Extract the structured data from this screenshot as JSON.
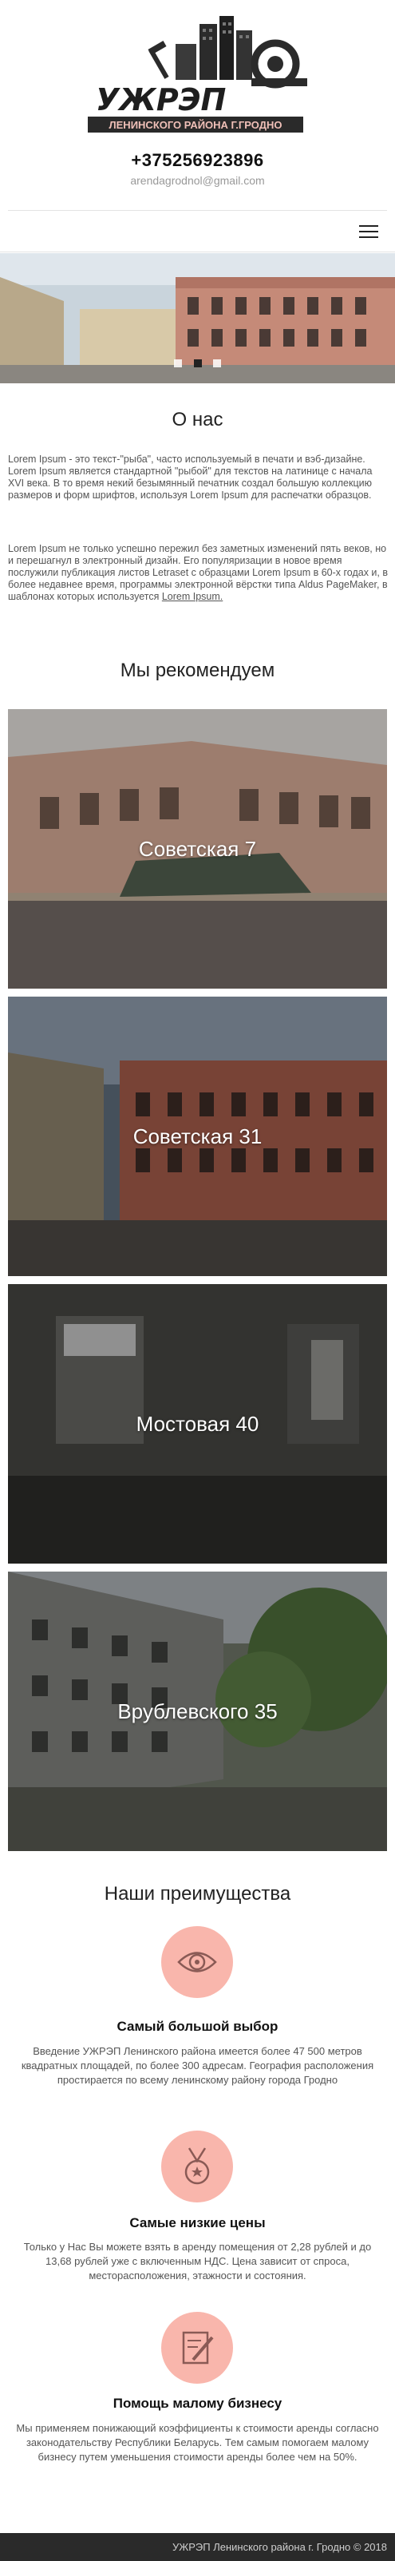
{
  "header": {
    "logo_title": "УЖРЭП",
    "logo_subtitle": "ЛЕНИНСКОГО РАЙОНА Г.ГРОДНО",
    "phone": "+375256923896",
    "email": "arendagrodnol@gmail.com",
    "menu_icon": "hamburger-icon"
  },
  "slider": {
    "slide_count": 3,
    "active_index": 1
  },
  "about": {
    "title": "О нас",
    "paragraph1": "Lorem Ipsum - это текст-\"рыба\", часто используемый в печати и вэб-дизайне. Lorem Ipsum является стандартной \"рыбой\" для текстов на латинице с начала XVI века. В то время некий безымянный печатник создал большую коллекцию размеров и форм шрифтов, используя Lorem Ipsum для распечатки образцов.",
    "paragraph2": "Lorem Ipsum не только успешно пережил без заметных изменений пять веков, но и перешагнул в электронный дизайн. Его популяризации в новое время послужили публикация листов Letraset с образцами Lorem Ipsum в 60-х годах и, в более недавнее время, программы электронной вёрстки типа Aldus PageMaker, в шаблонах которых используется",
    "link": "Lorem Ipsum."
  },
  "recommend": {
    "title": "Мы рекомендуем",
    "items": [
      {
        "label": "Советская 7"
      },
      {
        "label": "Советская 31"
      },
      {
        "label": "Мостовая 40"
      },
      {
        "label": "Врублевского 35"
      }
    ]
  },
  "advantages": {
    "title": "Наши преимущества",
    "items": [
      {
        "icon": "eye-icon",
        "title": "Самый большой выбор",
        "text": "Введение УЖРЭП Ленинского района имеется более 47 500 метров квадратных площадей, по более 300 адресам. География расположения простирается по всему ленинскому району города Гродно"
      },
      {
        "icon": "medal-icon",
        "title": "Самые низкие цены",
        "text": "Только у Нас Вы можете взять в аренду помещения от 2,28 рублей и до 13,68 рублей уже с включенным НДС. Цена зависит от спроса, месторасположения, этажности и состояния."
      },
      {
        "icon": "edit-icon",
        "title": "Помощь малому бизнесу",
        "text": "Мы применяем понижающий коэффициенты к стоимости аренды согласно законодательству Республики Беларусь. Тем самым помогаем малому бизнесу путем уменьшения стоимости аренды более чем на 50%."
      }
    ]
  },
  "footer": {
    "text": "УЖРЭП Ленинского района г. Гродно © 2018"
  },
  "colors": {
    "accent": "#f9b6ac",
    "footer_bg": "#2a2a2a",
    "text": "#555555"
  }
}
